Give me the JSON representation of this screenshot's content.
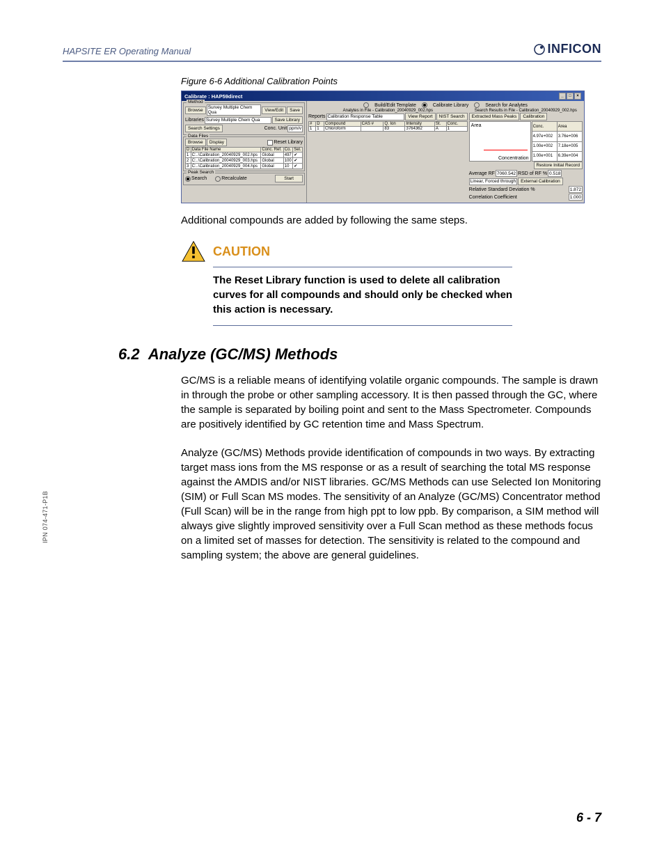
{
  "header": {
    "manual_title": "HAPSITE ER Operating Manual",
    "logo_text": "INFICON"
  },
  "figure": {
    "caption": "Figure 6-6 Additional Calibration Points",
    "window_title": "Calibrate : HAP59direct",
    "method_label": "Method",
    "browse": "Browse",
    "method_value": "Survey Multiple Chem Qua",
    "view_edit": "View/Edit",
    "save": "Save",
    "libraries_label": "Libraries",
    "libraries_value": "Survey Multiple Chem Qua",
    "save_library": "Save Library",
    "search_settings": "Search Settings",
    "conc_unit_label": "Conc. Unit",
    "conc_unit_value": "ppm/v",
    "data_files_label": "Data Files",
    "reset_library": "Reset Library",
    "display": "Display",
    "df_headers": [
      "D",
      "Data File Name",
      "Conc. Ref.",
      "Co.",
      "Sel."
    ],
    "df_rows": [
      {
        "d": "1",
        "name": "C:..\\Calibration_20040929_002.hps",
        "ref": "Global",
        "co": "497",
        "sel": "✔"
      },
      {
        "d": "2",
        "name": "C:..\\Calibration_20040929_003.hps",
        "ref": "Global",
        "co": "100",
        "sel": "✔"
      },
      {
        "d": "3",
        "name": "C:..\\Calibration_20040929_004.hps",
        "ref": "Global",
        "co": "10",
        "sel": "✔"
      }
    ],
    "peak_search_label": "Peak Search",
    "search_radio": "Search",
    "recalculate_radio": "Recalculate",
    "start": "Start",
    "radio_build": "Build/Edit Template",
    "radio_calibrate": "Calibrate Library",
    "radio_search": "Search for Analytes",
    "analytes_in_file": "Analytes in File - Calibration_20040929_002.hps",
    "search_results_in_file": "Search Results in File - Calibration_20040929_002.hps",
    "reports_label": "Reports",
    "reports_value": "Calibration Response Table",
    "view_report": "View Report",
    "nist_search": "NIST Search",
    "extracted_mass_peaks": "Extracted Mass Peaks",
    "calibration_btn": "Calibration",
    "comp_headers": [
      "#",
      "D",
      "Compound",
      "CAS #",
      "Q. Ion",
      "Intensity",
      "St.",
      "Conc."
    ],
    "comp_row": {
      "n": "1",
      "d": "1",
      "name": "Chloroform",
      "cas": "",
      "qion": "83",
      "intensity": "3764362",
      "st": "A",
      "conc": "1"
    },
    "chart_axis": "Area",
    "conc_table_header": [
      "Conc.",
      "Area"
    ],
    "conc_rows": [
      [
        "4.97e+002",
        "3.76e+006"
      ],
      [
        "1.00e+002",
        "7.18e+005"
      ],
      [
        "1.00e+001",
        "6.39e+004"
      ]
    ],
    "concentration_label": "Concentration",
    "restore_initial": "Restore Initial Record",
    "avg_rf_label": "Average RF",
    "avg_rf_val": "7060.542",
    "rsd_rf_label": "RSD of RF %",
    "rsd_rf_val": "0.518",
    "linear_forced": "Linear, Forced through",
    "external_cal": "External Calibration",
    "rsd_label": "Relative Standard Deviation %",
    "rsd_val": "1.872",
    "corr_label": "Correlation Coefficient",
    "corr_val": "1.000"
  },
  "para1": "Additional compounds are added by following the same steps.",
  "caution": {
    "title": "CAUTION",
    "text": "The Reset Library function is used to delete all calibration curves for all compounds and should only be checked when this action is necessary."
  },
  "section": {
    "number": "6.2",
    "title": "Analyze (GC/MS) Methods"
  },
  "para2": "GC/MS is a reliable means of identifying volatile organic compounds. The sample is drawn in through the probe or other sampling accessory. It is then passed through the GC, where the sample is separated by boiling point and sent to the Mass Spectrometer. Compounds are positively identified by GC retention time and Mass Spectrum.",
  "para3": "Analyze (GC/MS) Methods provide identification of compounds in two ways. By extracting target mass ions from the MS response or as a result of searching the total MS response against the AMDIS and/or NIST libraries. GC/MS Methods can use Selected Ion Monitoring (SIM) or Full Scan MS modes. The sensitivity of an Analyze (GC/MS) Concentrator method (Full Scan) will be in the range from high ppt to low ppb. By comparison, a SIM method will always give slightly improved sensitivity over a Full Scan method as these methods focus on a limited set of masses for detection. The sensitivity is related to the compound and sampling system; the above are general guidelines.",
  "side_text": "IPN 074-471-P1B",
  "footer": "6 - 7"
}
